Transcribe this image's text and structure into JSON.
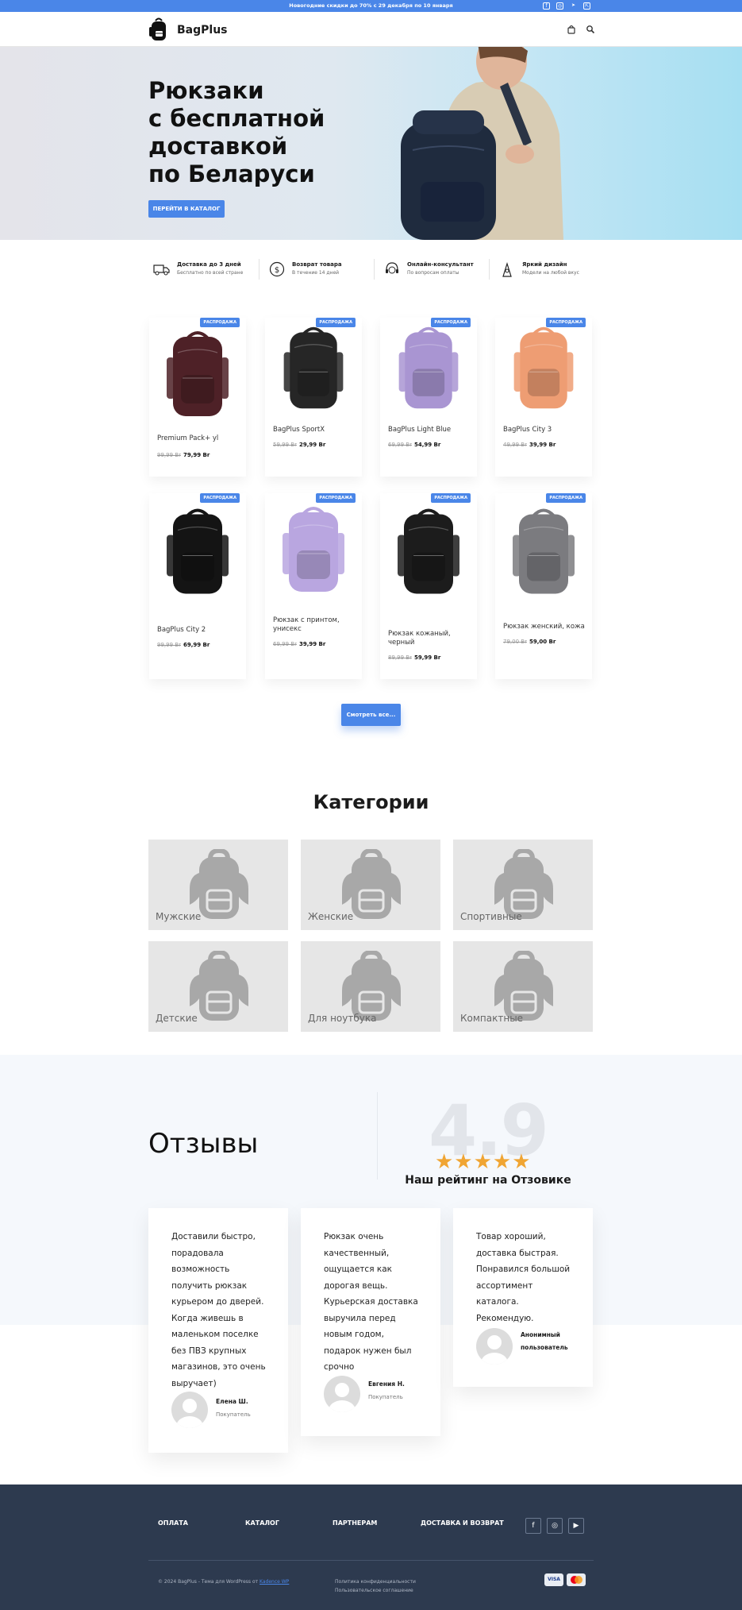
{
  "topbar": {
    "promo": "Новогодние скидки до 70% с 29 декабря по 10 января"
  },
  "header": {
    "logo_text": "BagPlus"
  },
  "hero": {
    "title_lines": [
      "Рюкзаки",
      "с бесплатной",
      "доставкой",
      "по Беларуси"
    ],
    "cta": "ПЕРЕЙТИ В КАТАЛОГ"
  },
  "features": [
    {
      "title": "Доставка до 3 дней",
      "subtitle": "Бесплатно по всей стране",
      "icon": "truck-icon"
    },
    {
      "title": "Возврат товара",
      "subtitle": "В течение 14 дней",
      "icon": "return-icon"
    },
    {
      "title": "Онлайн-консультант",
      "subtitle": "По вопросам оплаты",
      "icon": "headset-icon"
    },
    {
      "title": "Яркий дизайн",
      "subtitle": "Модели на любой вкус",
      "icon": "design-icon"
    }
  ],
  "products": [
    {
      "badge": "РАСПРОДАЖА",
      "name": "Premium Pack+ yl",
      "old_price": "99,99 Br",
      "price": "79,99 Br",
      "color": "#4e2127"
    },
    {
      "badge": "РАСПРОДАЖА",
      "name": "BagPlus SportX",
      "old_price": "59,99 Br",
      "price": "29,99 Br",
      "color": "#262626"
    },
    {
      "badge": "РАСПРОДАЖА",
      "name": "BagPlus Light Blue",
      "old_price": "69,99 Br",
      "price": "54,99 Br",
      "color": "#a995d2"
    },
    {
      "badge": "РАСПРОДАЖА",
      "name": "BagPlus City 3",
      "old_price": "49,99 Br",
      "price": "39,99 Br",
      "color": "#ee9d73"
    },
    {
      "badge": "РАСПРОДАЖА",
      "name": "BagPlus City 2",
      "old_price": "99,99 Br",
      "price": "69,99 Br",
      "color": "#141414"
    },
    {
      "badge": "РАСПРОДАЖА",
      "name": "Рюкзак с принтом, унисекс",
      "old_price": "69,99 Br",
      "price": "39,99 Br",
      "color": "#b9a6e0"
    },
    {
      "badge": "РАСПРОДАЖА",
      "name": "Рюкзак кожаный, черный",
      "old_price": "89,99 Br",
      "price": "59,99 Br",
      "color": "#1c1c1c"
    },
    {
      "badge": "РАСПРОДАЖА",
      "name": "Рюкзак женский, кожа",
      "old_price": "79,00 Br",
      "price": "59,00 Br",
      "color": "#7b7b7f"
    }
  ],
  "see_all": "Смотреть все...",
  "categories": {
    "title": "Категории",
    "items": [
      "Мужские",
      "Женские",
      "Спортивные",
      "Детские",
      "Для ноутбука",
      "Компактные"
    ]
  },
  "reviews": {
    "title": "Отзывы",
    "rating": "4.9",
    "rating_label": "Наш рейтинг на Отзовике",
    "items": [
      {
        "text": "Доставили быстро, порадовала возможность получить рюкзак курьером до дверей. Когда живешь в маленьком поселке без ПВЗ крупных магазинов, это очень выручает)",
        "name": "Елена Ш.",
        "role": "Покупатель"
      },
      {
        "text": "Рюкзак очень качественный, ощущается как дорогая вещь. Курьерская доставка выручила перед новым годом, подарок нужен был срочно",
        "name": "Евгения Н.",
        "role": "Покупатель"
      },
      {
        "text": "Товар хороший, доставка быстрая. Понравился большой ассортимент каталога. Рекомендую.",
        "name": "Анонимный пользователь",
        "role": ""
      }
    ]
  },
  "footer": {
    "links": [
      "ОПЛАТА",
      "КАТАЛОГ",
      "ПАРТНЕРАМ",
      "ДОСТАВКА И ВОЗВРАТ"
    ],
    "copyright": "© 2024 BagPlus - Тема для WordPress от ",
    "copyright_link": "Kadence WP",
    "policy": "Политика конфиденциальности",
    "agreement": "Пользовательское соглашение",
    "pay_visa": "VISA"
  },
  "colors": {
    "accent": "#4a86e8",
    "footer_bg": "#2d3a4f",
    "stars": "#f0a533"
  }
}
